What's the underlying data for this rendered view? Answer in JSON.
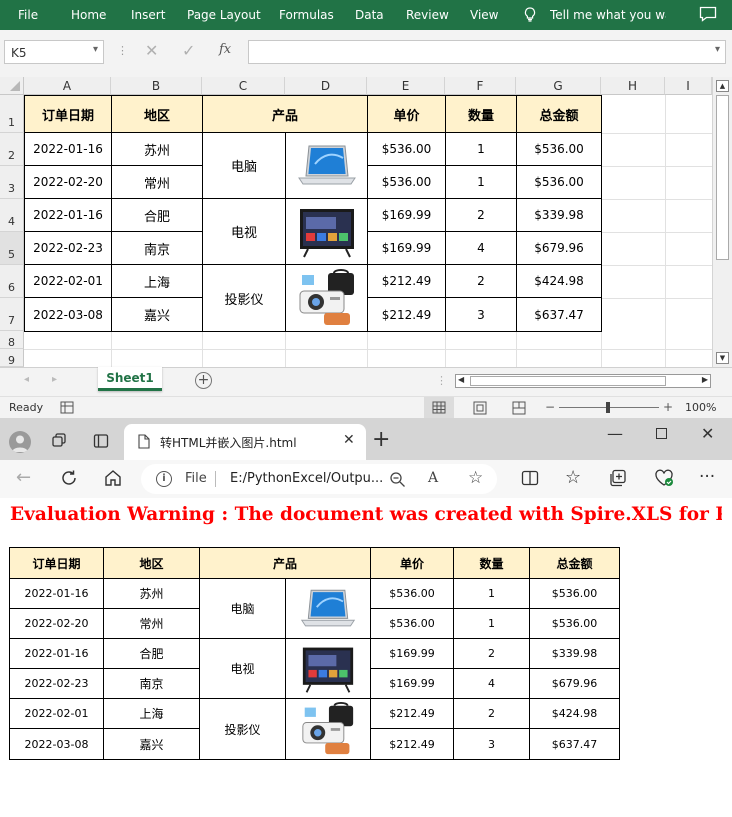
{
  "excel": {
    "ribbon_tabs": [
      "File",
      "Home",
      "Insert",
      "Page Layout",
      "Formulas",
      "Data",
      "Review",
      "View"
    ],
    "tell_me": "Tell me what you want",
    "name_box": "K5",
    "fx_label": "fx",
    "column_headers": [
      "A",
      "B",
      "C",
      "D",
      "E",
      "F",
      "G",
      "H",
      "I"
    ],
    "row_headers": [
      "1",
      "2",
      "3",
      "4",
      "5",
      "6",
      "7",
      "8",
      "9"
    ],
    "sheet_tab": "Sheet1",
    "status": "Ready",
    "zoom": "100%"
  },
  "table": {
    "headers": {
      "date": "订单日期",
      "region": "地区",
      "product": "产品",
      "price": "单价",
      "qty": "数量",
      "total": "总金额"
    },
    "rows": [
      {
        "date": "2022-01-16",
        "region": "苏州",
        "price": "$536.00",
        "qty": "1",
        "total": "$536.00"
      },
      {
        "date": "2022-02-20",
        "region": "常州",
        "price": "$536.00",
        "qty": "1",
        "total": "$536.00"
      },
      {
        "date": "2022-01-16",
        "region": "合肥",
        "price": "$169.99",
        "qty": "2",
        "total": "$339.98"
      },
      {
        "date": "2022-02-23",
        "region": "南京",
        "price": "$169.99",
        "qty": "4",
        "total": "$679.96"
      },
      {
        "date": "2022-02-01",
        "region": "上海",
        "price": "$212.49",
        "qty": "2",
        "total": "$424.98"
      },
      {
        "date": "2022-03-08",
        "region": "嘉兴",
        "price": "$212.49",
        "qty": "3",
        "total": "$637.47"
      }
    ],
    "products": [
      "电脑",
      "电视",
      "投影仪"
    ]
  },
  "browser": {
    "tab_title": "转HTML并嵌入图片.html",
    "file_label": "File",
    "address": "E:/PythonExcel/Outpu...",
    "warning": "Evaluation Warning : The document was created with  Spire.XLS for Python"
  },
  "colors": {
    "excel_green": "#217346",
    "header_fill": "#fff2cc",
    "warning_red": "#ff0000"
  }
}
